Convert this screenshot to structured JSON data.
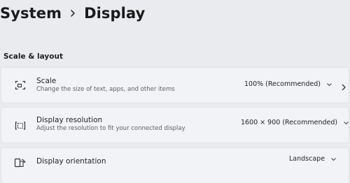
{
  "breadcrumb": {
    "parent": "System",
    "current": "Display"
  },
  "section": {
    "title": "Scale & layout"
  },
  "rows": [
    {
      "title": "Scale",
      "description": "Change the size of text, apps, and other items",
      "value": "100% (Recommended)",
      "icon": "scale-icon"
    },
    {
      "title": "Display resolution",
      "description": "Adjust the resolution to fit your connected display",
      "value": "1600 × 900 (Recommended)",
      "icon": "resolution-icon"
    },
    {
      "title": "Display orientation",
      "value": "Landscape",
      "icon": "orientation-icon"
    }
  ]
}
